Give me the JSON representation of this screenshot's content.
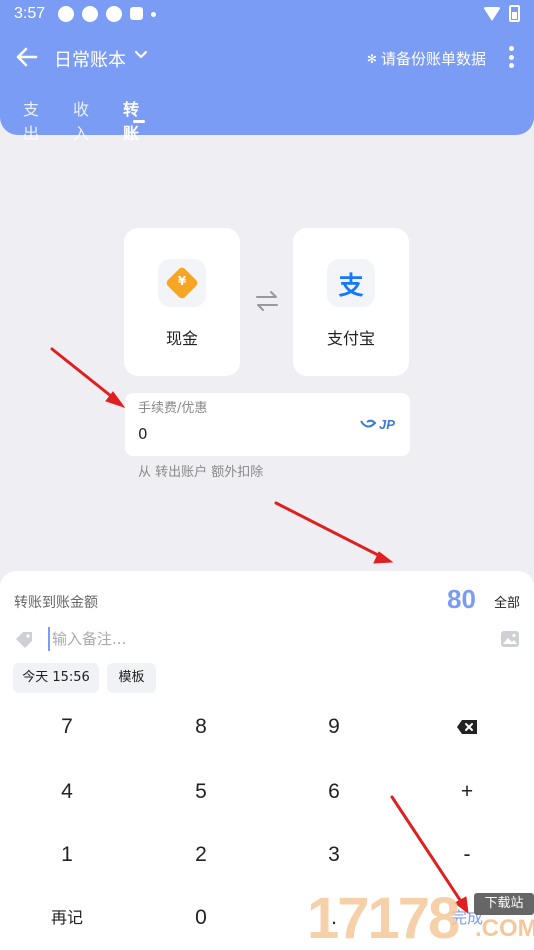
{
  "status_bar": {
    "time": "3:57"
  },
  "header": {
    "book_title": "日常账本",
    "backup_text": "请备份账单数据",
    "tabs": [
      {
        "label": "支出",
        "active": false
      },
      {
        "label": "收入",
        "active": false
      },
      {
        "label": "转账",
        "active": true
      }
    ]
  },
  "transfer": {
    "from_account": {
      "label": "现金",
      "icon": "cash-icon"
    },
    "to_account": {
      "label": "支付宝",
      "icon": "alipay-icon"
    },
    "fee": {
      "label": "手续费/优惠",
      "value": "0"
    },
    "fee_hint": "从 转出账户 额外扣除"
  },
  "sheet": {
    "amount_label": "转账到账金额",
    "amount_value": "80",
    "all_label": "全部",
    "note_placeholder": "输入备注...",
    "date_chip": "今天 15:56",
    "template_chip": "模板"
  },
  "keypad": {
    "keys": [
      "7",
      "8",
      "9",
      "4",
      "5",
      "6",
      "+",
      "1",
      "2",
      "3",
      "-",
      "0"
    ],
    "again_label": "再记",
    "dot_label": ".",
    "done_label": "完成"
  },
  "watermark": {
    "number": "17178",
    "site": "下载站",
    "domain": ".COM"
  },
  "colors": {
    "accent": "#7b9cf5",
    "cash": "#f6a623",
    "alipay": "#1677ff",
    "arrow": "#e02020"
  }
}
